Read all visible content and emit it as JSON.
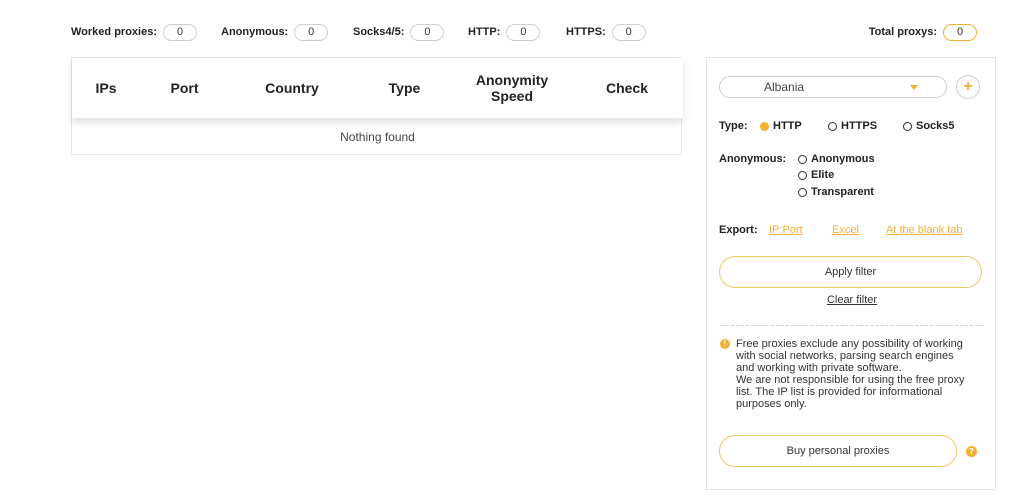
{
  "stats": {
    "worked": {
      "label": "Worked proxies:",
      "value": "0"
    },
    "anonymous": {
      "label": "Anonymous:",
      "value": "0"
    },
    "socks": {
      "label": "Socks4/5:",
      "value": "0"
    },
    "http": {
      "label": "HTTP:",
      "value": "0"
    },
    "https": {
      "label": "HTTPS:",
      "value": "0"
    },
    "total": {
      "label": "Total proxys:",
      "value": "0"
    }
  },
  "table": {
    "columns": {
      "ips": "IPs",
      "port": "Port",
      "country": "Country",
      "type": "Type",
      "anonymity_line1": "Anonymity",
      "anonymity_line2": "Speed",
      "check": "Check"
    },
    "empty_text": "Nothing found"
  },
  "filter": {
    "country": "Albania",
    "add_icon": "plus-icon",
    "type_label": "Type:",
    "type_options": [
      "HTTP",
      "HTTPS",
      "Socks5"
    ],
    "type_selected": "HTTP",
    "anonymous_label": "Anonymous:",
    "anonymous_options": [
      "Anonymous",
      "Elite",
      "Transparent"
    ],
    "export_label": "Export:",
    "export_links": [
      "IP:Port",
      "Excel",
      "At the blank tab"
    ],
    "apply_label": "Apply filter",
    "clear_label": "Clear filter",
    "notice_lines": [
      "Free proxies exclude any possibility of working",
      "with social networks, parsing search engines",
      "and working with private software.",
      "We are not responsible for using the free proxy",
      "list. The IP list is provided for informational",
      "purposes only."
    ],
    "buy_label": "Buy personal proxies"
  },
  "colors": {
    "accent": "#f2b134",
    "border": "#cfcfcf"
  }
}
